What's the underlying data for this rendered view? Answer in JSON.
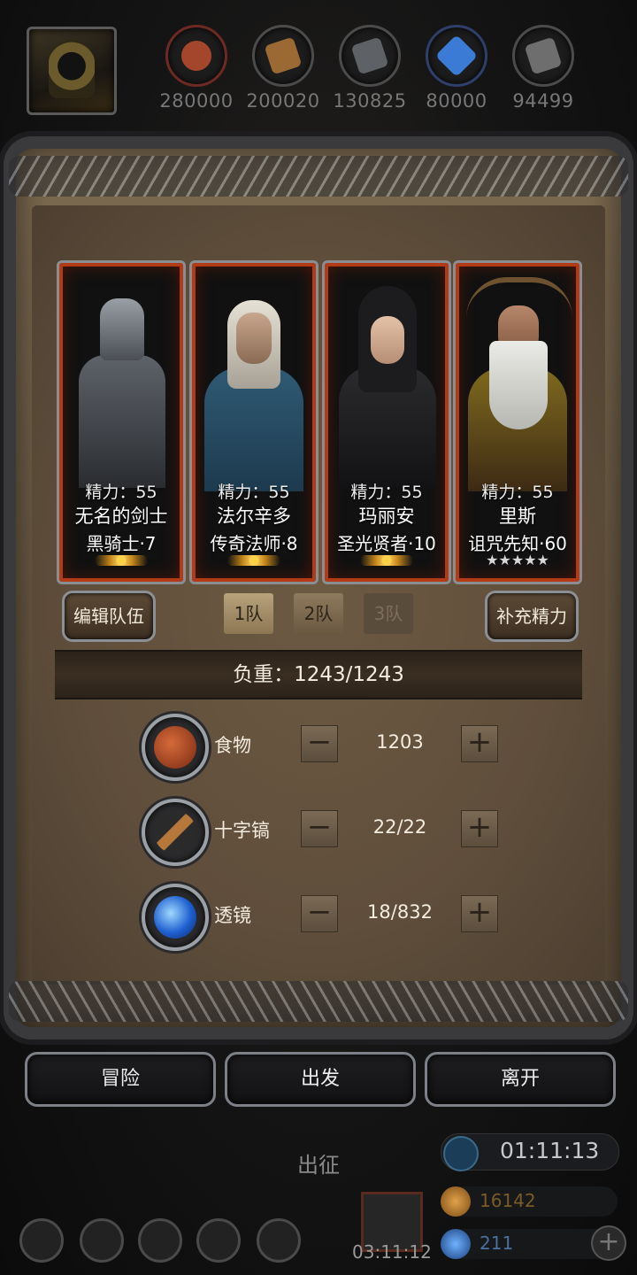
{
  "resources": [
    {
      "icon": "meat-icon",
      "value": "280000",
      "color": "#a3462b"
    },
    {
      "icon": "wood-icon",
      "value": "200020",
      "color": "#9b6a34"
    },
    {
      "icon": "iron-icon",
      "value": "130825",
      "color": "#5e6266"
    },
    {
      "icon": "crystal-icon",
      "value": "80000",
      "color": "#3b7bd6"
    },
    {
      "icon": "ore-icon",
      "value": "94499",
      "color": "#6e6e6e"
    }
  ],
  "heroes": [
    {
      "stamina": "精力：55",
      "name": "无名的剑士",
      "class": "黑骑士·7",
      "stars": ""
    },
    {
      "stamina": "精力：55",
      "name": "法尔辛多",
      "class": "传奇法师·8",
      "stars": ""
    },
    {
      "stamina": "精力：55",
      "name": "玛丽安",
      "class": "圣光贤者·10",
      "stars": ""
    },
    {
      "stamina": "精力：55",
      "name": "里斯",
      "class": "诅咒先知·60",
      "stars": "★★★★★"
    }
  ],
  "team": {
    "edit_label": "编辑队伍",
    "tabs": [
      "1队",
      "2队",
      "3队"
    ],
    "refill_label": "补充精力"
  },
  "load": "负重：1243/1243",
  "supplies": [
    {
      "icon": "food-icon",
      "label": "食物",
      "value": "1203"
    },
    {
      "icon": "pickaxe-icon",
      "label": "十字镐",
      "value": "22/22"
    },
    {
      "icon": "lens-icon",
      "label": "透镜",
      "value": "18/832"
    }
  ],
  "buttons": {
    "adventure": "冒险",
    "depart": "出发",
    "leave": "离开"
  },
  "hud": {
    "expedition": "出征",
    "timer": "01:11:13",
    "gold": "16142",
    "gems": "211",
    "gift_timer": "03:11:12"
  },
  "colors": {
    "accent_red": "#b23a14",
    "gold": "#c98a1c",
    "frame": "#8c8f94"
  }
}
